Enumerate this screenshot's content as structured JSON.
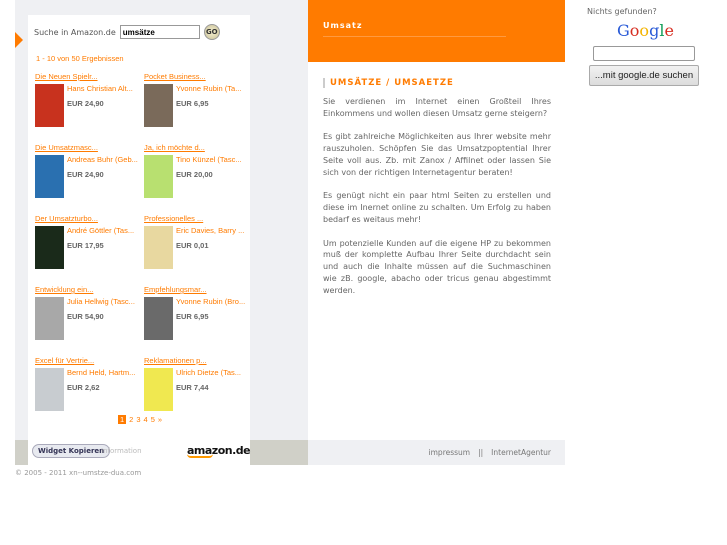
{
  "amazon": {
    "search_label": "Suche in Amazon.de",
    "search_value": "umsätze",
    "go": "GO",
    "results": "1 - 10 von 50 Ergebnissen",
    "items": [
      {
        "title": "Die Neuen Spielr...",
        "author": "Hans Christian Alt...",
        "price": "EUR 24,90",
        "color": "#c8321e"
      },
      {
        "title": "Pocket Business...",
        "author": "Yvonne Rubin (Ta...",
        "price": "EUR 6,95",
        "color": "#7a6a5a"
      },
      {
        "title": "Die Umsatzmasc...",
        "author": "Andreas Buhr (Geb...",
        "price": "EUR 24,90",
        "color": "#2a70b0"
      },
      {
        "title": "Ja, ich möchte d...",
        "author": "Tino Künzel (Tasc...",
        "price": "EUR 20,00",
        "color": "#b8e070"
      },
      {
        "title": "Der Umsatzturbo...",
        "author": "André Göttler (Tas...",
        "price": "EUR 17,95",
        "color": "#1a2a1a"
      },
      {
        "title": "Professionelles ...",
        "author": "Eric Davies, Barry ...",
        "price": "EUR 0,01",
        "color": "#e8d8a0"
      },
      {
        "title": "Entwicklung ein...",
        "author": "Julia Hellwig (Tasc...",
        "price": "EUR 54,90",
        "color": "#a8a8a8"
      },
      {
        "title": "Empfehlungsmar...",
        "author": "Yvonne Rubin (Bro...",
        "price": "EUR 6,95",
        "color": "#6a6a6a"
      },
      {
        "title": "Excel für Vertrie...",
        "author": "Bernd Held, Hartm...",
        "price": "EUR 2,62",
        "color": "#c8ccd0"
      },
      {
        "title": "Reklamationen p...",
        "author": "Ulrich Dietze (Tas...",
        "price": "EUR 7,44",
        "color": "#f0e850"
      }
    ],
    "pages": [
      "1",
      "2",
      "3",
      "4",
      "5",
      "»"
    ],
    "widget_button": "Widget Kopieren",
    "information": "Information",
    "logo": "amazon.de"
  },
  "header": {
    "title": "Umsatz"
  },
  "content": {
    "heading": "UMSÄTZE / UMSAETZE",
    "paragraphs": [
      "Sie verdienen im Internet einen Großteil Ihres Einkommens und wollen diesen Umsatz gerne steigern?",
      "Es gibt zahlreiche Möglichkeiten aus Ihrer website mehr rauszuholen. Schöpfen Sie das Umsatzpoptential Ihrer Seite voll aus. Zb. mit Zanox / Affilnet oder lassen Sie sich von der richtigen Internetagentur beraten!",
      "Es genügt nicht ein paar html Seiten zu erstellen und diese im Inernet online zu schalten. Um Erfolg zu haben bedarf es weitaus mehr!",
      "Um potenzielle Kunden auf die eigene HP zu bekommen muß der komplette Aufbau Ihrer Seite durchdacht sein und auch die Inhalte müssen auf die Suchmaschinen wie zB. google, abacho oder tricus genau abgestimmt werden."
    ]
  },
  "footer": {
    "impressum": "impressum",
    "sep": "||",
    "agentur": "InternetAgentur",
    "copyright": "© 2005 - 2011 xn--umstze-dua.com"
  },
  "google": {
    "prompt": "Nichts gefunden?",
    "logo": "Google",
    "button": "...mit google.de suchen",
    "input_value": ""
  }
}
